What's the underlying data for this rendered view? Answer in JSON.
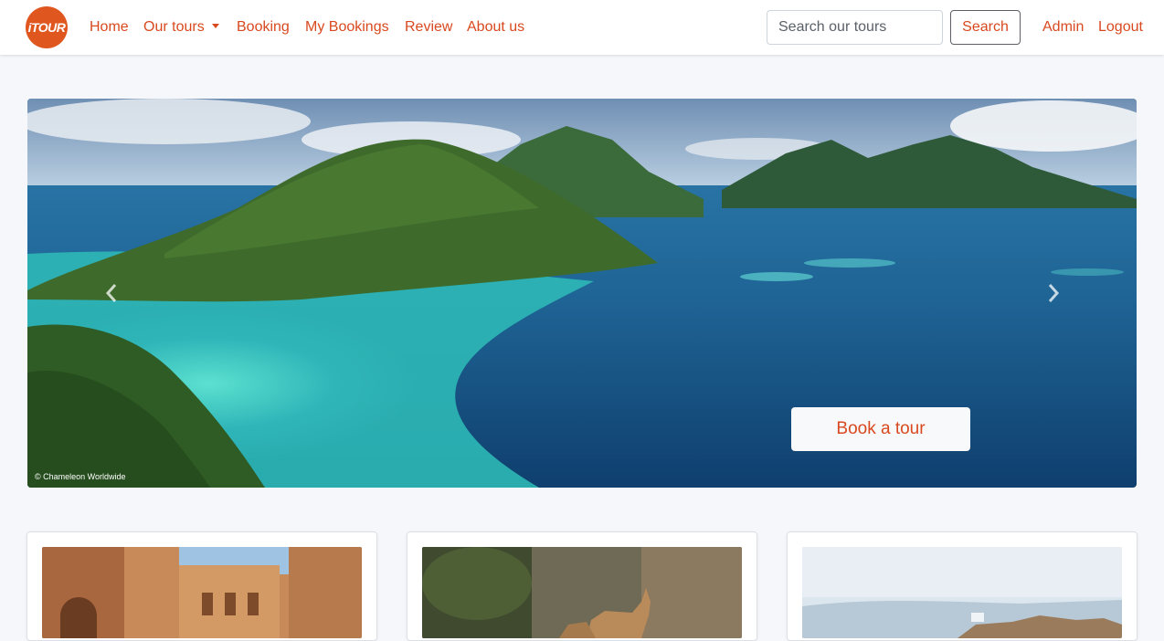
{
  "brand": {
    "logo_text": "iTOUR",
    "accent": "#d9491f",
    "logo_bg": "#e0561f"
  },
  "nav": {
    "home": "Home",
    "tours": "Our tours",
    "booking": "Booking",
    "my_bookings": "My Bookings",
    "review": "Review",
    "about": "About us",
    "admin": "Admin",
    "logout": "Logout"
  },
  "search": {
    "placeholder": "Search our tours",
    "value": "",
    "button": "Search"
  },
  "hero": {
    "book_button": "Book a tour",
    "photo_credit": "© Chameleon Worldwide",
    "prev_icon": "chevron-left-icon",
    "next_icon": "chevron-right-icon"
  },
  "cards": [
    {
      "name": "tour-card-old-city"
    },
    {
      "name": "tour-card-gazelle"
    },
    {
      "name": "tour-card-desert-fortress"
    }
  ]
}
